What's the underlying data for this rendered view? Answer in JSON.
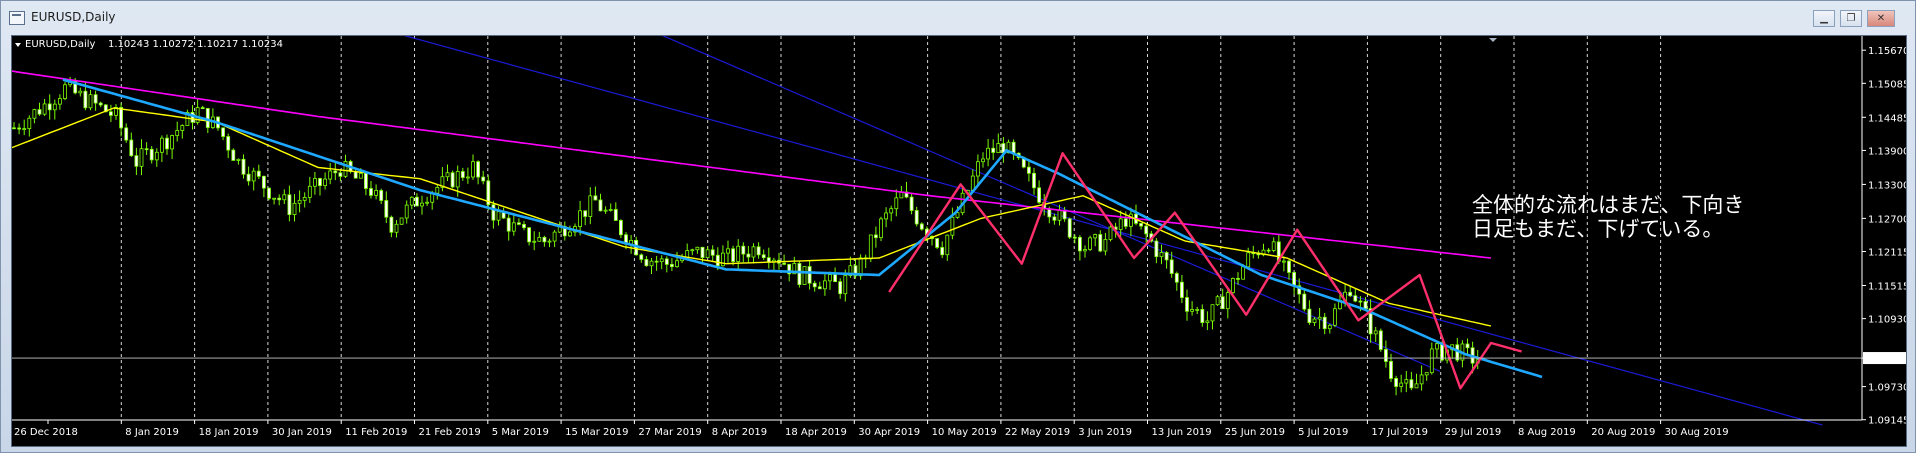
{
  "window": {
    "title": "EURUSD,Daily",
    "buttons": [
      "minimize",
      "maximize",
      "close"
    ]
  },
  "chart_header": {
    "symbol": "EURUSD,Daily",
    "ohlc": "1.10243 1.10272 1.10217 1.10234"
  },
  "price_axis": [
    "1.15670",
    "1.15085",
    "1.14485",
    "1.13900",
    "1.13300",
    "1.12700",
    "1.12115",
    "1.11515",
    "1.10930",
    "1.10234",
    "1.09730",
    "1.09145"
  ],
  "current_price": "1.10234",
  "date_axis": [
    "26 Dec 2018",
    "8 Jan 2019",
    "18 Jan 2019",
    "30 Jan 2019",
    "11 Feb 2019",
    "21 Feb 2019",
    "5 Mar 2019",
    "15 Mar 2019",
    "27 Mar 2019",
    "8 Apr 2019",
    "18 Apr 2019",
    "30 Apr 2019",
    "10 May 2019",
    "22 May 2019",
    "3 Jun 2019",
    "13 Jun 2019",
    "25 Jun 2019",
    "5 Jul 2019",
    "17 Jul 2019",
    "29 Jul 2019",
    "8 Aug 2019",
    "20 Aug 2019",
    "30 Aug 2019"
  ],
  "annotation": {
    "line1": "全体的な流れはまだ、下向き",
    "line2": "日足もまだ、下げている。"
  },
  "colors": {
    "background": "#000000",
    "bull": "#7cfc00",
    "ma_slow": "#ff00ff",
    "ma_mid": "#ffff00",
    "ma_fast": "#1ea8ff",
    "zigzag": "#ff2f6b",
    "channel": "#1a1ad6"
  },
  "chart_data": {
    "type": "candlestick",
    "symbol": "EURUSD",
    "timeframe": "Daily",
    "ylim": [
      1.0914,
      1.1585
    ],
    "y_ticks": [
      1.1567,
      1.15085,
      1.14485,
      1.139,
      1.133,
      1.127,
      1.12115,
      1.11515,
      1.1093,
      1.0973,
      1.09145
    ],
    "x_labels": [
      "26 Dec 2018",
      "8 Jan 2019",
      "18 Jan 2019",
      "30 Jan 2019",
      "11 Feb 2019",
      "21 Feb 2019",
      "5 Mar 2019",
      "15 Mar 2019",
      "27 Mar 2019",
      "8 Apr 2019",
      "18 Apr 2019",
      "30 Apr 2019",
      "10 May 2019",
      "22 May 2019",
      "3 Jun 2019",
      "13 Jun 2019",
      "25 Jun 2019",
      "5 Jul 2019",
      "17 Jul 2019",
      "29 Jul 2019",
      "8 Aug 2019",
      "20 Aug 2019",
      "30 Aug 2019"
    ],
    "close_path": [
      [
        0,
        1.143
      ],
      [
        6,
        1.147
      ],
      [
        10,
        1.15
      ],
      [
        14,
        1.148
      ],
      [
        20,
        1.145
      ],
      [
        24,
        1.137
      ],
      [
        30,
        1.141
      ],
      [
        36,
        1.146
      ],
      [
        40,
        1.143
      ],
      [
        44,
        1.137
      ],
      [
        50,
        1.132
      ],
      [
        54,
        1.129
      ],
      [
        60,
        1.133
      ],
      [
        64,
        1.136
      ],
      [
        70,
        1.132
      ],
      [
        74,
        1.126
      ],
      [
        80,
        1.131
      ],
      [
        86,
        1.134
      ],
      [
        90,
        1.136
      ],
      [
        94,
        1.128
      ],
      [
        100,
        1.124
      ],
      [
        104,
        1.123
      ],
      [
        110,
        1.127
      ],
      [
        114,
        1.13
      ],
      [
        118,
        1.126
      ],
      [
        124,
        1.12
      ],
      [
        128,
        1.119
      ],
      [
        134,
        1.121
      ],
      [
        140,
        1.12
      ],
      [
        146,
        1.122
      ],
      [
        150,
        1.12
      ],
      [
        154,
        1.117
      ],
      [
        158,
        1.116
      ],
      [
        162,
        1.115
      ],
      [
        166,
        1.119
      ],
      [
        170,
        1.126
      ],
      [
        174,
        1.131
      ],
      [
        178,
        1.126
      ],
      [
        182,
        1.122
      ],
      [
        186,
        1.13
      ],
      [
        190,
        1.138
      ],
      [
        194,
        1.14
      ],
      [
        198,
        1.135
      ],
      [
        202,
        1.13
      ],
      [
        206,
        1.126
      ],
      [
        210,
        1.122
      ],
      [
        214,
        1.123
      ],
      [
        218,
        1.127
      ],
      [
        222,
        1.124
      ],
      [
        226,
        1.119
      ],
      [
        230,
        1.112
      ],
      [
        234,
        1.109
      ],
      [
        238,
        1.114
      ],
      [
        242,
        1.12
      ],
      [
        246,
        1.123
      ],
      [
        250,
        1.116
      ],
      [
        254,
        1.11
      ],
      [
        258,
        1.109
      ],
      [
        262,
        1.115
      ],
      [
        266,
        1.108
      ],
      [
        270,
        1.1
      ],
      [
        274,
        1.096
      ],
      [
        278,
        1.103
      ],
      [
        282,
        1.104
      ],
      [
        286,
        1.1023
      ]
    ],
    "ma_slow": [
      [
        0,
        1.153
      ],
      [
        60,
        1.145
      ],
      [
        120,
        1.138
      ],
      [
        180,
        1.131
      ],
      [
        230,
        1.126
      ],
      [
        290,
        1.12
      ]
    ],
    "ma_mid": [
      [
        0,
        1.1395
      ],
      [
        20,
        1.1465
      ],
      [
        40,
        1.144
      ],
      [
        60,
        1.136
      ],
      [
        80,
        1.134
      ],
      [
        100,
        1.128
      ],
      [
        120,
        1.122
      ],
      [
        140,
        1.119
      ],
      [
        170,
        1.12
      ],
      [
        190,
        1.127
      ],
      [
        210,
        1.131
      ],
      [
        230,
        1.123
      ],
      [
        250,
        1.12
      ],
      [
        270,
        1.112
      ],
      [
        290,
        1.108
      ]
    ],
    "ma_fast": [
      [
        10,
        1.1515
      ],
      [
        40,
        1.144
      ],
      [
        80,
        1.132
      ],
      [
        110,
        1.125
      ],
      [
        140,
        1.118
      ],
      [
        170,
        1.117
      ],
      [
        185,
        1.128
      ],
      [
        195,
        1.139
      ],
      [
        205,
        1.135
      ],
      [
        225,
        1.126
      ],
      [
        245,
        1.117
      ],
      [
        265,
        1.111
      ],
      [
        285,
        1.103
      ],
      [
        300,
        1.099
      ]
    ],
    "zigzag": [
      [
        172,
        1.114
      ],
      [
        186,
        1.133
      ],
      [
        198,
        1.119
      ],
      [
        206,
        1.1385
      ],
      [
        220,
        1.12
      ],
      [
        228,
        1.128
      ],
      [
        242,
        1.11
      ],
      [
        252,
        1.125
      ],
      [
        264,
        1.109
      ],
      [
        276,
        1.117
      ],
      [
        284,
        1.097
      ],
      [
        290,
        1.105
      ],
      [
        296,
        1.1035
      ]
    ],
    "channel_upper": [
      [
        68,
        1.1615
      ],
      [
        355,
        1.0905
      ]
    ],
    "channel_lower": [
      [
        100,
        1.17
      ],
      [
        280,
        1.1
      ]
    ],
    "current_price": 1.10234
  }
}
